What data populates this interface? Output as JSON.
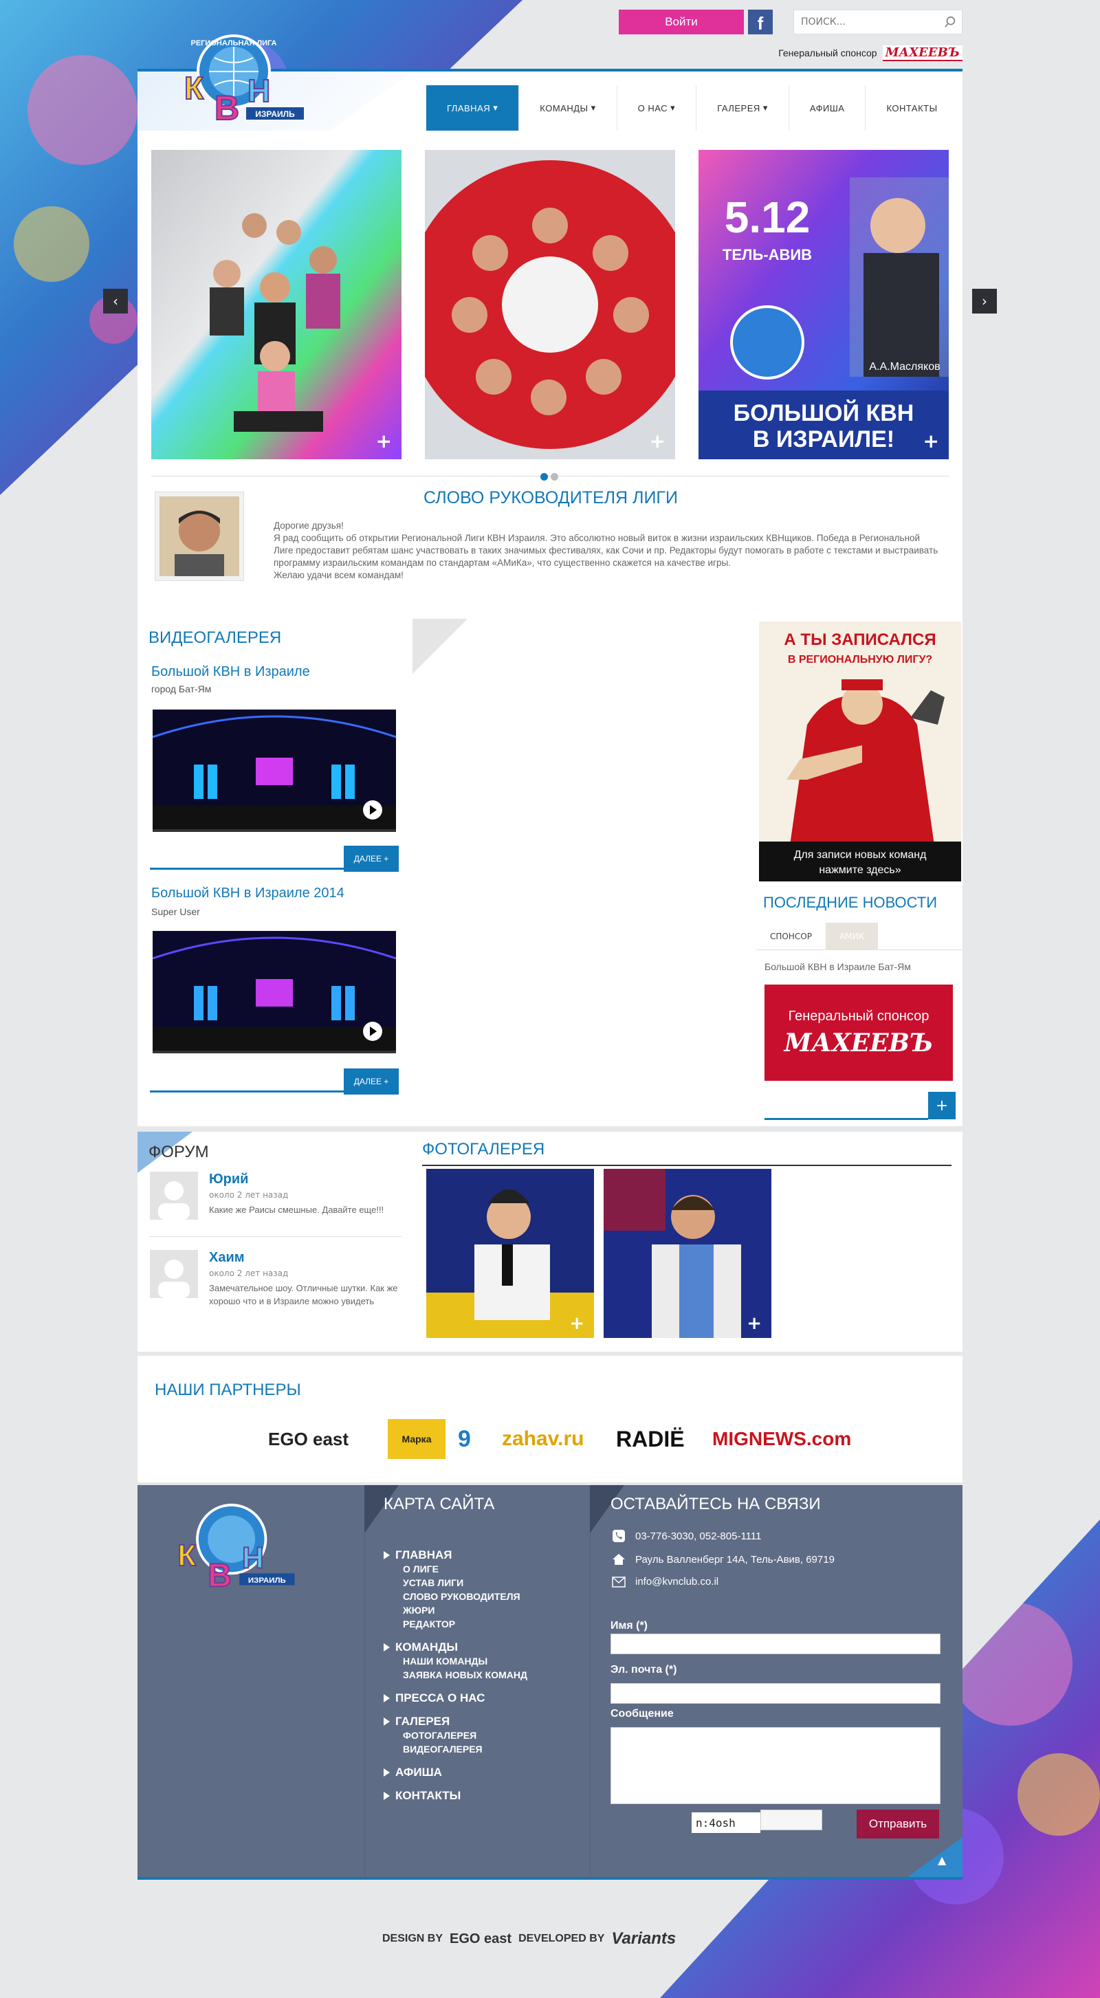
{
  "header": {
    "login_label": "Войти",
    "search_placeholder": "ПОИСК...",
    "sponsor_label": "Генеральный спонсор",
    "sponsor_logo_text": "МАХЕЕВЪ",
    "logo": {
      "top_text": "РЕГИОНАЛЬНАЯ ЛИГА",
      "letters": "КВН",
      "bottom_text": "ИЗРАИЛЬ"
    }
  },
  "nav": {
    "items": [
      {
        "label": "ГЛАВНАЯ",
        "has_dropdown": true,
        "active": true
      },
      {
        "label": "КОМАНДЫ",
        "has_dropdown": true,
        "active": false
      },
      {
        "label": "О НАС",
        "has_dropdown": true,
        "active": false
      },
      {
        "label": "ГАЛЕРЕЯ",
        "has_dropdown": true,
        "active": false
      },
      {
        "label": "АФИША",
        "has_dropdown": false,
        "active": false
      },
      {
        "label": "КОНТАКТЫ",
        "has_dropdown": false,
        "active": false
      }
    ]
  },
  "slider": {
    "slide3": {
      "date": "5.12",
      "city": "ТЕЛЬ-АВИВ",
      "person": "А.А.Масляков",
      "headline1": "БОЛЬШОЙ КВН",
      "headline2": "В ИЗРАИЛЕ!"
    },
    "dots": 2,
    "active_dot": 1
  },
  "head_word": {
    "title": "СЛОВО РУКОВОДИТЕЛЯ ЛИГИ",
    "paragraphs": [
      "Дорогие друзья!",
      "Я рад сообщить об открытии Региональной Лиги КВН Израиля. Это абсолютно новый виток в жизни израильских КВНщиков. Победа в Региональной Лиге предоставит ребятам шанс участвовать в таких значимых фестивалях, как Сочи и пр. Редакторы будут помогать в работе с текстами и выстраивать программу израильским командам по стандартам «АМиКа», что существенно скажется на качестве игры.",
      "Желаю удачи всем командам!"
    ]
  },
  "video_gallery": {
    "title": "ВИДЕОГАЛЕРЕЯ",
    "items": [
      {
        "title": "Большой КВН в Израиле",
        "subtitle": "город Бат-Ям",
        "more": "ДАЛЕЕ +"
      },
      {
        "title": "Большой КВН в Израиле 2014",
        "subtitle": "Super User",
        "more": "ДАЛЕЕ +"
      }
    ]
  },
  "promo": {
    "line1": "А ТЫ ЗАПИСАЛСЯ",
    "line2": "В РЕГИОНАЛЬНУЮ ЛИГУ?",
    "cta1": "Для записи новых команд",
    "cta2": "нажмите здесь»"
  },
  "news": {
    "title": "ПОСЛЕДНИЕ НОВОСТИ",
    "tabs": [
      "СПОНСОР",
      "АМИК"
    ],
    "item": "Большой КВН в Израиле Бат-Ям",
    "sponsor_label": "Генеральный спонсор",
    "sponsor_logo": "МАХЕЕВЪ",
    "plus": "+"
  },
  "forum": {
    "title": "ФОРУМ",
    "posts": [
      {
        "name": "Юрий",
        "time": "около 2 лет назад",
        "text": "Какие же Раисы смешные. Давайте еще!!!"
      },
      {
        "name": "Хаим",
        "time": "около 2 лет назад",
        "text": "Замечательное шоу. Отличные шутки. Как же хорошо что и в Израиле можно увидеть"
      }
    ]
  },
  "photo_gallery": {
    "title": "ФОТОГАЛЕРЕЯ",
    "plus": "+"
  },
  "partners": {
    "title": "НАШИ ПАРТНЕРЫ",
    "logos": [
      "EGO east",
      "Марка",
      "9",
      "zahav.ru",
      "RADIЁ",
      "MIGNEWS.com"
    ]
  },
  "footer": {
    "sitemap_title": "КАРТА САЙТА",
    "contact_title": "ОСТАВАЙТЕСЬ НА СВЯЗИ",
    "menu": [
      {
        "label": "ГЛАВНАЯ",
        "sub": [
          "О ЛИГЕ",
          "УСТАВ ЛИГИ",
          "СЛОВО РУКОВОДИТЕЛЯ",
          "ЖЮРИ",
          "РЕДАКТОР"
        ]
      },
      {
        "label": "КОМАНДЫ",
        "sub": [
          "НАШИ КОМАНДЫ",
          "ЗАЯВКА НОВЫХ КОМАНД"
        ]
      },
      {
        "label": "ПРЕССА О НАС",
        "sub": []
      },
      {
        "label": "ГАЛЕРЕЯ",
        "sub": [
          "ФОТОГАЛЕРЕЯ",
          "ВИДЕОГАЛЕРЕЯ"
        ]
      },
      {
        "label": "АФИША",
        "sub": []
      },
      {
        "label": "КОНТАКТЫ",
        "sub": []
      }
    ],
    "phone": "03-776-3030, 052-805-1111",
    "address": "Рауль Валленберг 14А, Тель-Авив, 69719",
    "email": "info@kvnclub.co.il",
    "form": {
      "name_label": "Имя (*)",
      "email_label": "Эл. почта (*)",
      "message_label": "Сообщение",
      "captcha": "n:4osh",
      "submit": "Отправить"
    }
  },
  "credits": {
    "design_by": "DESIGN BY",
    "design_logo": "EGO east",
    "developed_by": "DEVELOPED BY",
    "dev_logo": "Variants"
  }
}
